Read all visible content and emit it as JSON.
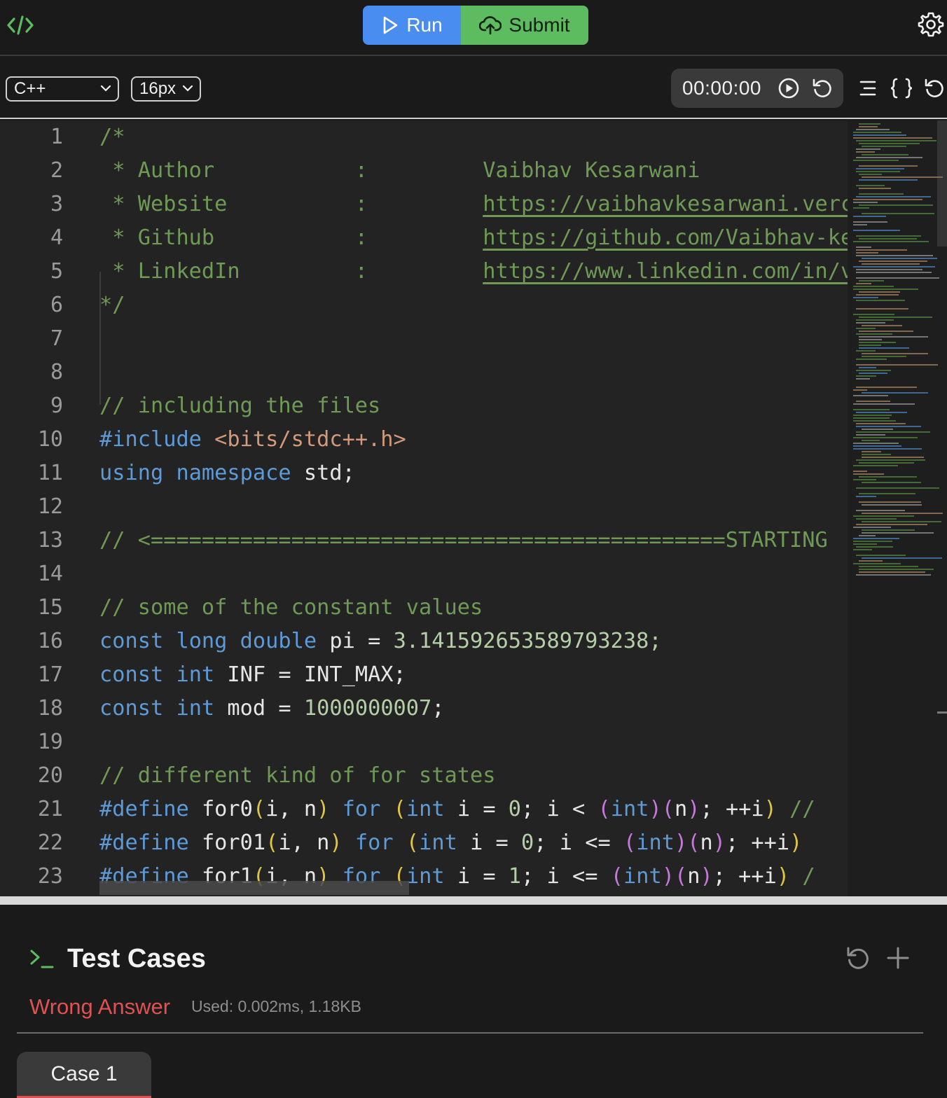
{
  "topbar": {
    "run_label": "Run",
    "submit_label": "Submit"
  },
  "toolbar": {
    "language": "C++",
    "font_size": "16px",
    "timer": "00:00:00"
  },
  "colors": {
    "run": "#4a8df0",
    "submit": "#5cbc5f",
    "error": "#e05252",
    "comment": "#6e9a55",
    "keyword": "#5c9ad8"
  },
  "editor": {
    "line_numbers": [
      "1",
      "2",
      "3",
      "4",
      "5",
      "6",
      "7",
      "8",
      "9",
      "10",
      "11",
      "12",
      "13",
      "14",
      "15",
      "16",
      "17",
      "18",
      "19",
      "20",
      "21",
      "22",
      "23"
    ],
    "lines": {
      "l1": "/*",
      "l2_a": " * Author           :         ",
      "l2_b": "Vaibhav Kesarwani",
      "l3_a": " * Website          :         ",
      "l3_b": "https://vaibhavkesarwani.verc",
      "l4_a": " * Github           :         ",
      "l4_b": "https://github.com/Vaibhav-ke",
      "l5_a": " * LinkedIn         :         ",
      "l5_b": "https://www.linkedin.com/in/v",
      "l6": "*/",
      "l9": "// including the files",
      "l10_a": "#include ",
      "l10_b": "<bits/stdc++.h>",
      "l11_a": "using",
      "l11_b": "namespace",
      "l11_c": " std;",
      "l13": "// <=============================================STARTING",
      "l15": "// some of the constant values",
      "l16_a": "const",
      "l16_b": "long",
      "l16_c": "double",
      "l16_d": " pi = ",
      "l16_e": "3.1415926535897932",
      "l16_f": "38;",
      "l17_a": "const",
      "l17_b": "int",
      "l17_c": " INF = INT_MAX;",
      "l18_a": "const",
      "l18_b": "int",
      "l18_c": " mod = ",
      "l18_d": "1000000007",
      "l18_e": ";",
      "l20": "// different kind of for states",
      "define": "#define",
      "l21_name": "for0",
      "l22_name": "for01",
      "l23_name": "for1",
      "args": "i, n",
      "for_kw": "for",
      "int_kw": "int",
      "l21_rest": " i = ",
      "zero": "0",
      "one": "1",
      "l21_cond": "; i < ",
      "l22_cond": "; i <= ",
      "n_arg": "n",
      "inc": "; ++i",
      "trail": " //",
      "trail2": " /"
    }
  },
  "panel": {
    "title": "Test Cases",
    "verdict": "Wrong Answer",
    "used": "Used: 0.002ms, 1.18KB",
    "case_tab": "Case 1"
  }
}
